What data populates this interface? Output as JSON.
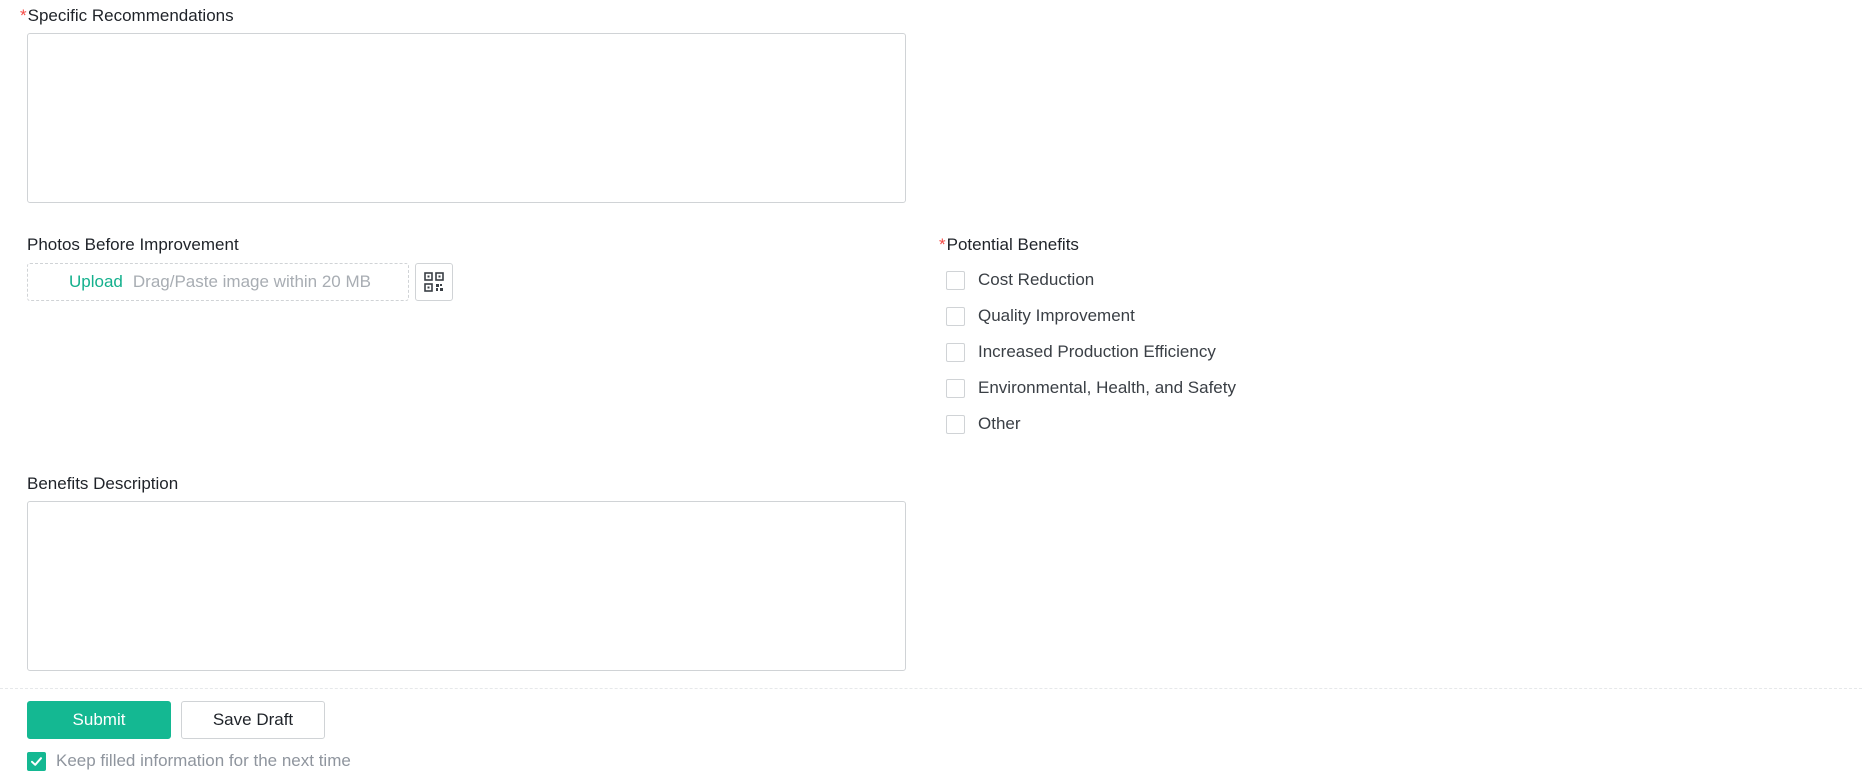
{
  "form": {
    "specific_recommendations": {
      "required_mark": "*",
      "label": "Specific Recommendations",
      "value": ""
    },
    "photos_before": {
      "label": "Photos Before Improvement",
      "upload_label": "Upload",
      "upload_hint": "Drag/Paste image within 20 MB"
    },
    "potential_benefits": {
      "required_mark": "*",
      "label": "Potential Benefits",
      "options": [
        {
          "label": "Cost Reduction",
          "checked": false
        },
        {
          "label": "Quality Improvement",
          "checked": false
        },
        {
          "label": "Increased Production Efficiency",
          "checked": false
        },
        {
          "label": "Environmental, Health, and Safety",
          "checked": false
        },
        {
          "label": "Other",
          "checked": false
        }
      ]
    },
    "benefits_description": {
      "label": "Benefits Description",
      "value": ""
    }
  },
  "footer": {
    "submit_label": "Submit",
    "save_draft_label": "Save Draft",
    "keep_info_label": "Keep filled information for the next time",
    "keep_info_checked": true
  },
  "colors": {
    "accent": "#14b892",
    "required": "#f54a45",
    "border": "#d0d3d6"
  },
  "icons": {
    "qr": "qr-code-icon",
    "check": "check-icon"
  }
}
